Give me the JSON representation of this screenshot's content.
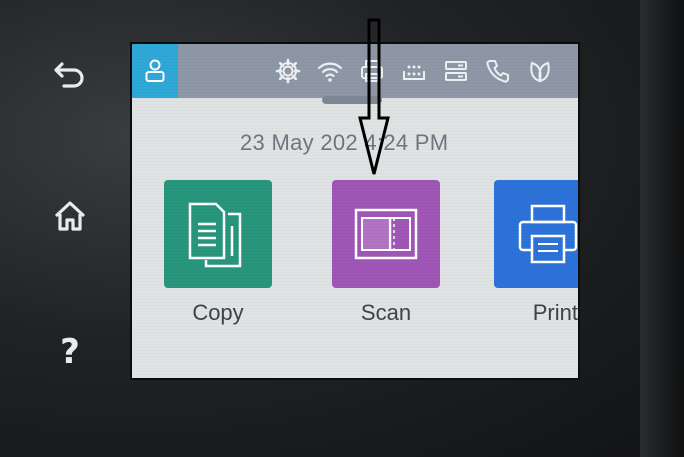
{
  "side_buttons": {
    "back": {
      "icon": "back-arrow-icon"
    },
    "home": {
      "icon": "home-icon"
    },
    "help": {
      "icon": "help-icon",
      "label": "?"
    }
  },
  "status_bar": {
    "icons": [
      "user-icon",
      "settings-gear-icon",
      "wifi-icon",
      "printer-status-icon",
      "ink-levels-icon",
      "tray-icon",
      "phone-icon",
      "leaf-eco-icon"
    ],
    "colors": {
      "bar": "#8d97a6",
      "user_tile": "#2fa8d8"
    }
  },
  "home": {
    "datetime": "23 May 202 4:24 PM",
    "tiles": [
      {
        "id": "copy",
        "label": "Copy",
        "icon": "copy-icon",
        "color": "#28967d"
      },
      {
        "id": "scan",
        "label": "Scan",
        "icon": "scan-icon",
        "color": "#9f56b6"
      },
      {
        "id": "print",
        "label": "Print",
        "icon": "print-icon",
        "color": "#2d72d8"
      }
    ]
  },
  "annotation": {
    "icon": "down-arrow-annotation"
  }
}
